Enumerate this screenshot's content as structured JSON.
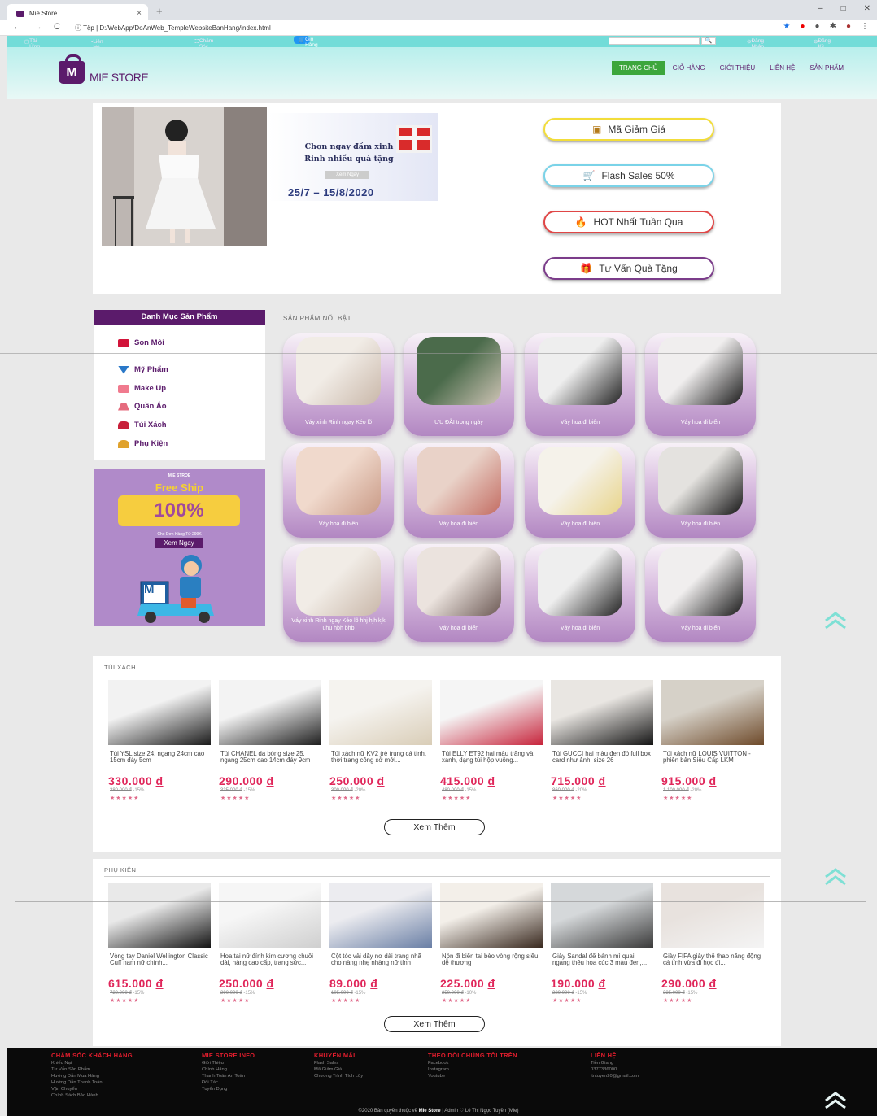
{
  "browser": {
    "tab_title": "Mie Store",
    "tab_close": "×",
    "new_tab": "+",
    "url_prefix": "Tệp",
    "url": "D:/WebApp/DoAnWeb_TempleWebsiteBanHang/index.html",
    "window_controls": [
      "–",
      "□",
      "✕"
    ]
  },
  "topbar": {
    "items": [
      "Tải Ứng Dụng",
      "Liên Hệ Đối Tác",
      "Chăm Sóc Khách Hàng"
    ],
    "cart": "Giỏ Hàng",
    "search_placeholder": "",
    "search_icon": "search-icon",
    "login": "Đăng Nhập",
    "register": "Đăng Ký"
  },
  "header": {
    "logo_letter": "M",
    "logo_text": "MIE STORE",
    "nav": [
      "TRANG CHỦ",
      "GIỎ HÀNG",
      "GIỚI THIỆU",
      "LIÊN HỆ",
      "SẢN PHẨM"
    ]
  },
  "banner": {
    "promo_line1": "Chọn ngay đầm xinh",
    "promo_line2": "Rinh nhiều quà tặng",
    "promo_button": "Xem Ngay",
    "promo_date": "25/7 – 15/8/2020",
    "buttons": [
      "Mã Giảm Giá",
      "Flash Sales 50%",
      "HOT Nhất Tuần Qua",
      "Tư Vấn Quà Tặng"
    ]
  },
  "sidebar": {
    "title": "Danh Mục Sản Phẩm",
    "items": [
      "Son Môi",
      "Mỹ Phẩm",
      "Make Up",
      "Quần Áo",
      "Túi Xách",
      "Phụ Kiện"
    ],
    "freeship": {
      "brand": "MIE STROE",
      "title": "Free Ship",
      "percent": "100%",
      "note": "Cho Đơn Hàng Từ 299K",
      "button": "Xem Ngay",
      "badge": "M"
    }
  },
  "featured": {
    "title": "SẢN PHẨM NỔI BẬT",
    "items": [
      "Váy xinh Rinh ngay Kéo lõ",
      "ƯU ĐÃI trong ngày",
      "Váy hoa đi biển",
      "Váy hoa đi biển",
      "Váy hoa đi biển",
      "Váy hoa đi biển",
      "Váy hoa đi biển",
      "Váy hoa đi biển",
      "Váy xinh Rinh ngay Kéo lõ hhj hjh kjk uhu hbh bhb",
      "Váy hoa đi biển",
      "Váy hoa đi biển",
      "Váy hoa đi biển"
    ]
  },
  "bags": {
    "title": "TÚI XÁCH",
    "more": "Xem Thêm",
    "items": [
      {
        "name": "Túi YSL size 24, ngang 24cm cao 15cm đáy 5cm",
        "price": "330.000",
        "currency": "đ",
        "old": "380.000 đ",
        "discount": "-15%"
      },
      {
        "name": "Túi CHANEL da bóng size 25, ngang 25cm cao 14cm đáy 9cm",
        "price": "290.000",
        "currency": "đ",
        "old": "335.000 đ",
        "discount": "-15%"
      },
      {
        "name": "Túi xách nữ KV2 trẻ trung cá tính, thời trang công sở mới...",
        "price": "250.000",
        "currency": "đ",
        "old": "300.000 đ",
        "discount": "-20%"
      },
      {
        "name": "Túi ELLY ET92 hai màu trắng và xanh, dạng túi hộp vuông...",
        "price": "415.000",
        "currency": "đ",
        "old": "480.000 đ",
        "discount": "-15%"
      },
      {
        "name": "Túi GUCCI hai màu đen đỏ full box card như ảnh, size 26",
        "price": "715.000",
        "currency": "đ",
        "old": "860.000 đ",
        "discount": "-20%"
      },
      {
        "name": "Túi xách nữ LOUIS VUITTON - phiên bản Siêu Cấp LKM",
        "price": "915.000",
        "currency": "đ",
        "old": "1.100.000 đ",
        "discount": "-20%"
      }
    ]
  },
  "accessories": {
    "title": "PHỤ KIỆN",
    "more": "Xem Thêm",
    "items": [
      {
        "name": "Vòng tay Daniel Wellington Classic Cuff nam nữ chính...",
        "price": "615.000",
        "currency": "đ",
        "old": "720.000 đ",
        "discount": "-15%"
      },
      {
        "name": "Hoa tai nữ đính kim cương chuỗi dài, hàng cao cấp, trang sức...",
        "price": "250.000",
        "currency": "đ",
        "old": "290.000 đ",
        "discount": "-15%"
      },
      {
        "name": "Cột tóc vải dây nơ dài trang nhã cho nàng nhẹ nhàng nữ tính",
        "price": "89.000",
        "currency": "đ",
        "old": "105.000 đ",
        "discount": "-15%"
      },
      {
        "name": "Nón đi biển tai bèo vòng rộng siêu dễ thương",
        "price": "225.000",
        "currency": "đ",
        "old": "250.000 đ",
        "discount": "-10%"
      },
      {
        "name": "Giày Sandal đế bánh mì quai ngang thêu hoa cúc 3 màu đen,...",
        "price": "190.000",
        "currency": "đ",
        "old": "220.000 đ",
        "discount": "-15%"
      },
      {
        "name": "Giày FIFA giày thể thao năng động cá tính vừa đi học đi...",
        "price": "290.000",
        "currency": "đ",
        "old": "335.000 đ",
        "discount": "-15%"
      }
    ]
  },
  "stars": "★★★★★",
  "footer": {
    "cols": [
      {
        "title": "CHĂM SÓC KHÁCH HÀNG",
        "items": [
          "Khiếu Nại",
          "Tư Vấn Sản Phẩm",
          "Hướng Dẫn Mua Hàng",
          "Hướng Dẫn Thanh Toán",
          "Vận Chuyển",
          "Chính Sách Bảo Hành"
        ]
      },
      {
        "title": "MIE STORE INFO",
        "items": [
          "Giới Thiệu",
          "Chính Hãng",
          "Thanh Toán An Toàn",
          "Đối Tác",
          "Tuyển Dụng"
        ]
      },
      {
        "title": "KHUYẾN MÃI",
        "items": [
          "Flash Sales",
          "Mã Giảm Giá",
          "Chương Trình Tích Lũy"
        ]
      },
      {
        "title": "THEO DÕI CHÚNG TÔI TRÊN",
        "items": [
          "Facebook",
          "Instagram",
          "Youtube"
        ]
      },
      {
        "title": "LIÊN HỆ",
        "items": [
          "Tiền Giang",
          "0377336000",
          "ltntuyen20@gmail.com"
        ]
      }
    ],
    "copyright_pre": "©2020 Bản quyền thuộc về",
    "copyright_brand": "Mie Store",
    "copyright_post": "| Admin ♡ Lê Thị Ngọc Tuyền (Mie)"
  },
  "colors": {
    "brand": "#5b1b6b",
    "teal": "#72dcd8",
    "price": "#e0265a",
    "nav_active": "#3ca63c"
  }
}
